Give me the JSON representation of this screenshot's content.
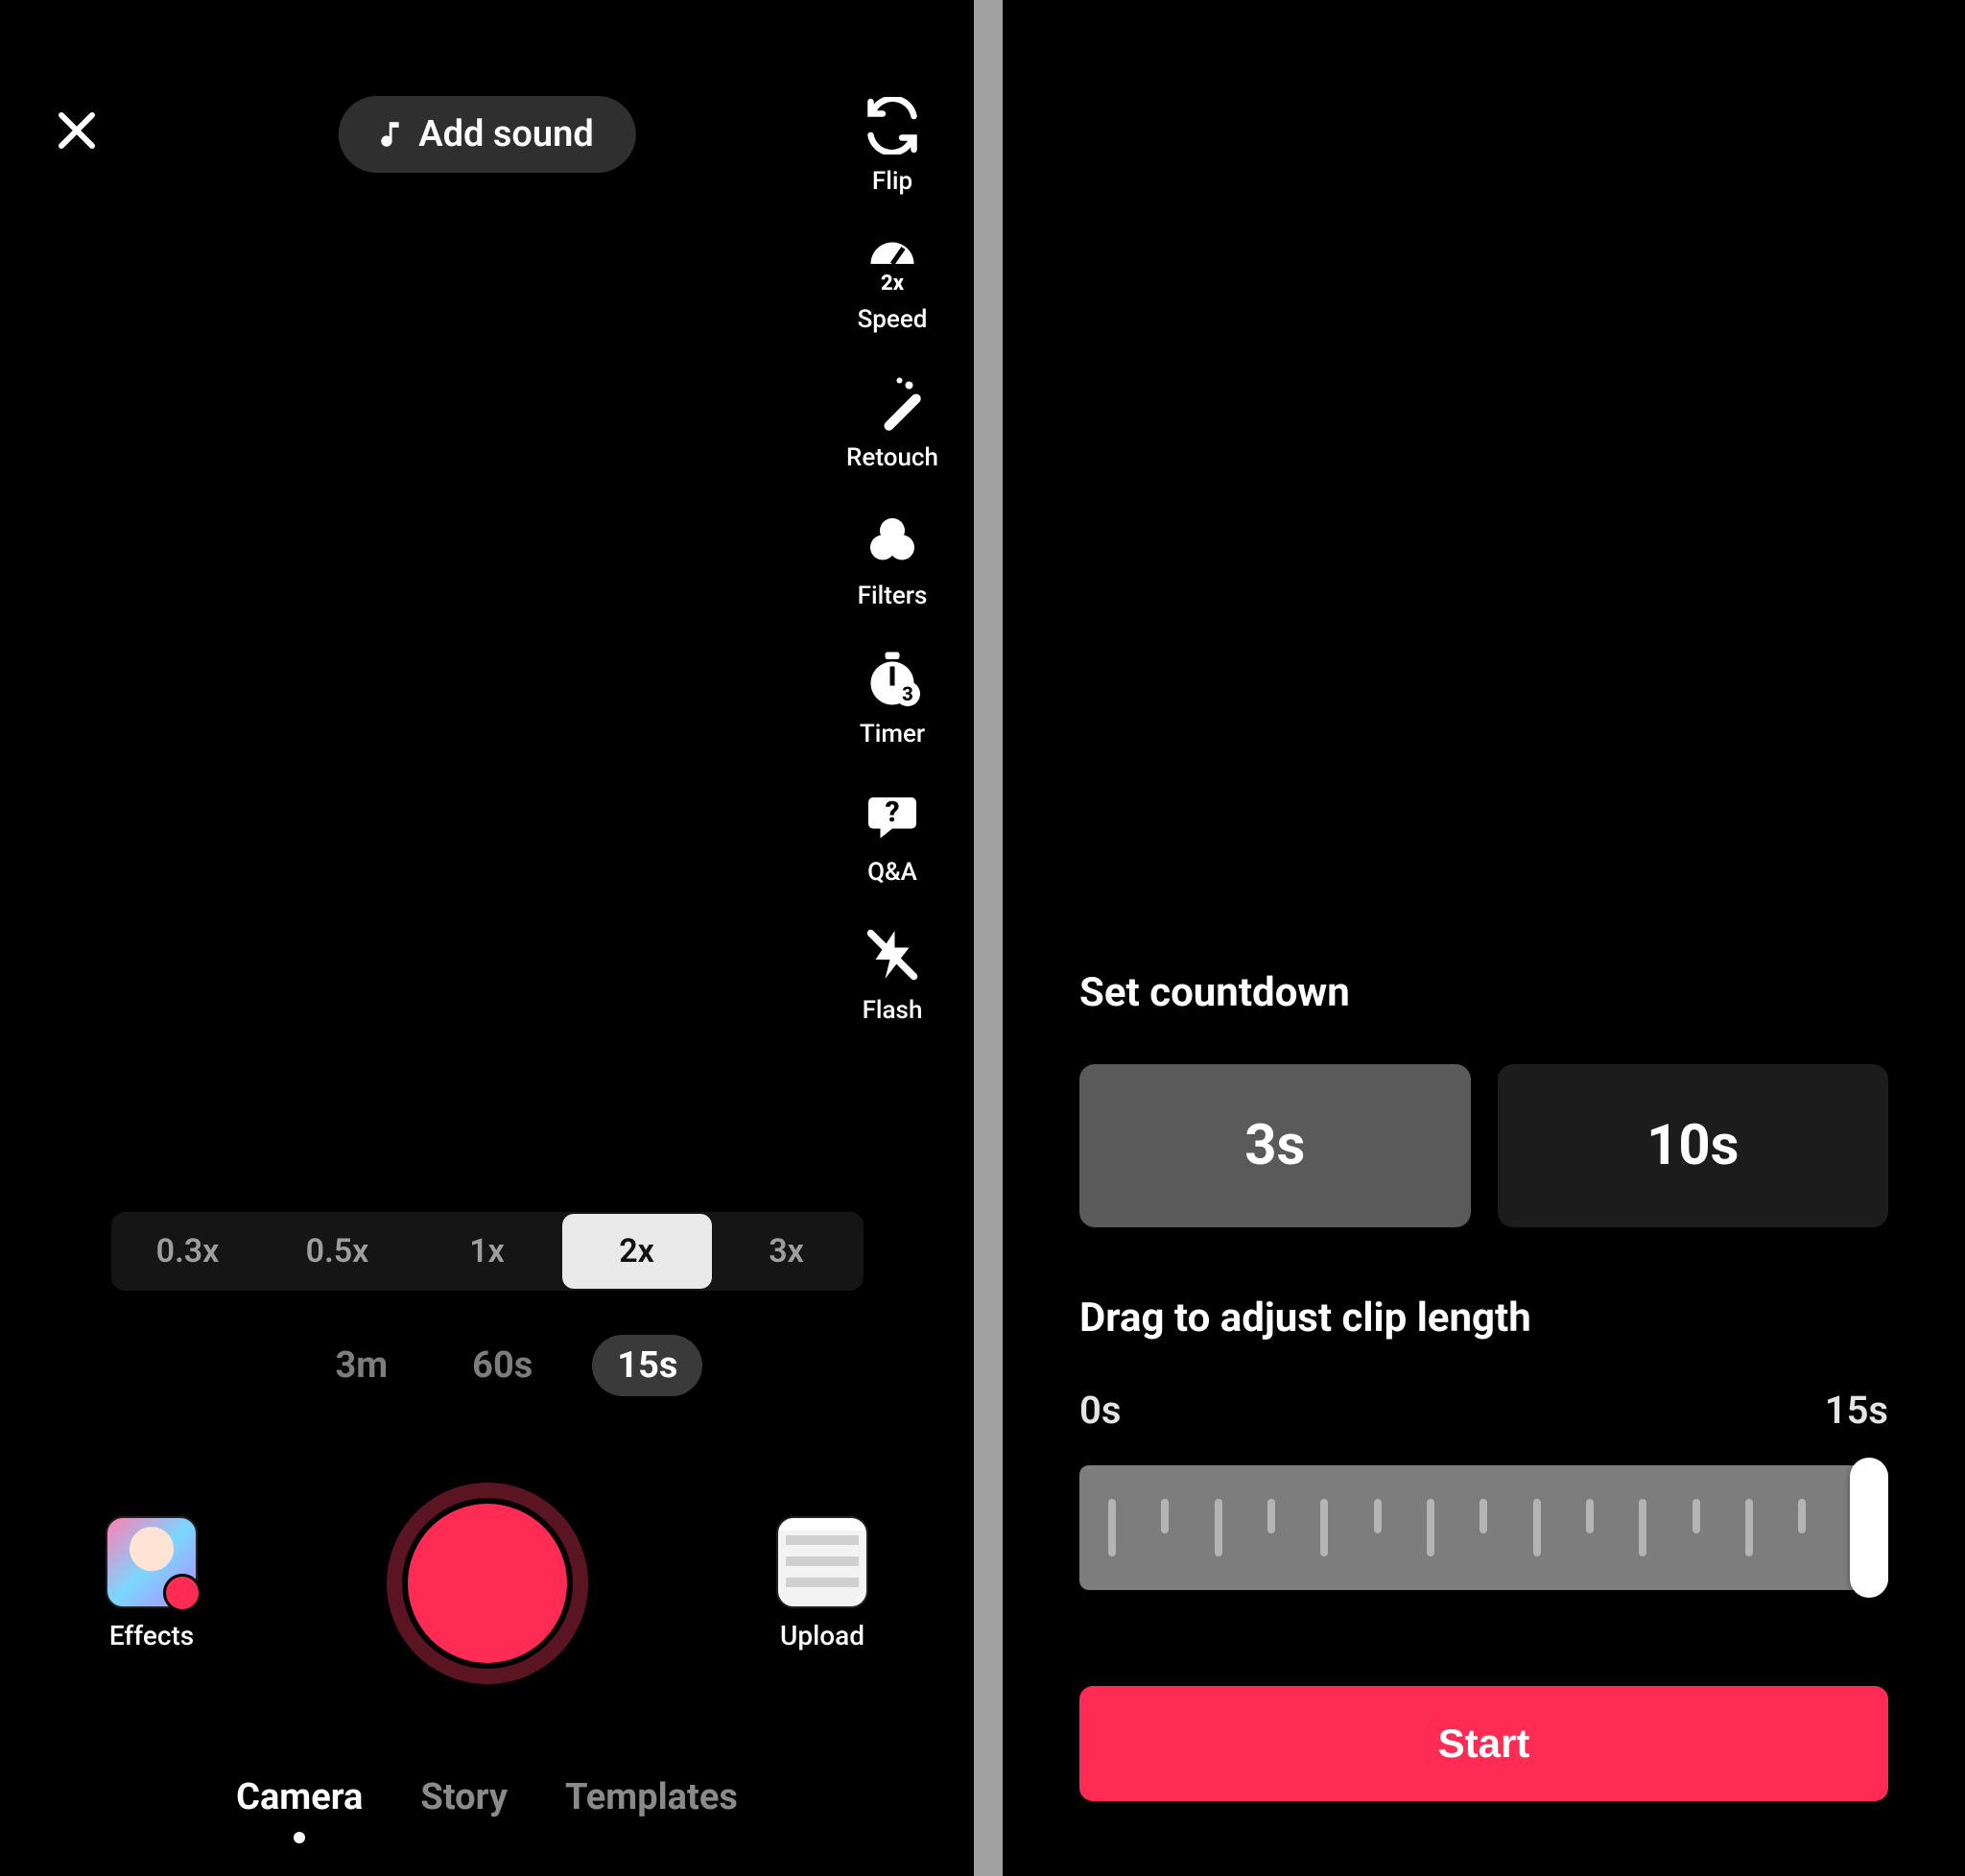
{
  "left": {
    "add_sound_label": "Add sound",
    "tools": {
      "flip": "Flip",
      "speed": "Speed",
      "retouch": "Retouch",
      "filters": "Filters",
      "timer": "Timer",
      "qa": "Q&A",
      "flash": "Flash"
    },
    "speed_badge": "2x",
    "timer_badge": "3",
    "speed_options": [
      "0.3x",
      "0.5x",
      "1x",
      "2x",
      "3x"
    ],
    "speed_active_index": 3,
    "duration_options": [
      "3m",
      "60s",
      "15s"
    ],
    "duration_active_index": 2,
    "effects_label": "Effects",
    "upload_label": "Upload",
    "mode_tabs": [
      "Camera",
      "Story",
      "Templates"
    ],
    "mode_active_index": 0
  },
  "right": {
    "countdown_title": "Set countdown",
    "countdown_options": [
      "3s",
      "10s"
    ],
    "countdown_active_index": 0,
    "drag_label": "Drag to adjust clip length",
    "range_start": "0s",
    "range_end": "15s",
    "start_label": "Start"
  }
}
